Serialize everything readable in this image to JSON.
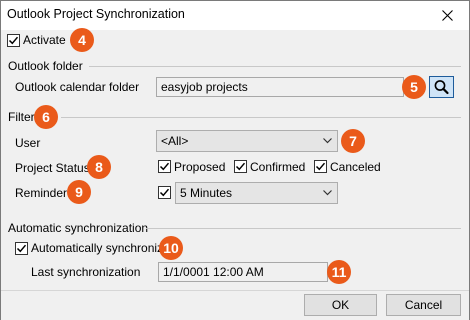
{
  "window": {
    "title": "Outlook Project Synchronization"
  },
  "activate": {
    "label": "Activate",
    "checked": true,
    "badge": "4"
  },
  "outlook_folder": {
    "section_label": "Outlook folder",
    "calendar_folder_label": "Outlook calendar folder",
    "calendar_folder_value": "easyjob projects",
    "badge": "5"
  },
  "filter": {
    "section_label": "Filter",
    "badge": "6",
    "user_label": "User",
    "user_value": "<All>",
    "user_badge": "7",
    "project_status_label": "Project Status",
    "project_status_badge": "8",
    "statuses": [
      {
        "label": "Proposed",
        "checked": true
      },
      {
        "label": "Confirmed",
        "checked": true
      },
      {
        "label": "Canceled",
        "checked": true
      }
    ],
    "reminder_label": "Reminder",
    "reminder_badge": "9",
    "reminder_checked": true,
    "reminder_value": "5 Minutes"
  },
  "auto_sync": {
    "section_label": "Automatic synchronization",
    "auto_label": "Automatically synchronize",
    "auto_checked": true,
    "auto_badge": "10",
    "last_sync_label": "Last synchronization",
    "last_sync_value": "1/1/0001 12:00 AM",
    "last_sync_badge": "11"
  },
  "buttons": {
    "ok": "OK",
    "cancel": "Cancel"
  },
  "colors": {
    "badge": "#ea5a1a",
    "search_button_border": "#1e5c9b"
  }
}
